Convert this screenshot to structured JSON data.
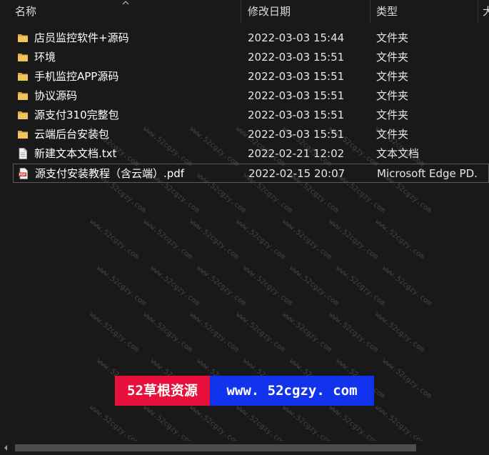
{
  "header": {
    "name": "名称",
    "date": "修改日期",
    "type": "类型",
    "size": "大"
  },
  "files": [
    {
      "name": "店员监控软件+源码",
      "date": "2022-03-03 15:44",
      "type": "文件夹",
      "icon": "folder-icon"
    },
    {
      "name": "环境",
      "date": "2022-03-03 15:51",
      "type": "文件夹",
      "icon": "folder-icon"
    },
    {
      "name": "手机监控APP源码",
      "date": "2022-03-03 15:51",
      "type": "文件夹",
      "icon": "folder-icon"
    },
    {
      "name": "协议源码",
      "date": "2022-03-03 15:51",
      "type": "文件夹",
      "icon": "folder-icon"
    },
    {
      "name": "源支付310完整包",
      "date": "2022-03-03 15:51",
      "type": "文件夹",
      "icon": "folder-icon"
    },
    {
      "name": "云端后台安装包",
      "date": "2022-03-03 15:51",
      "type": "文件夹",
      "icon": "folder-icon"
    },
    {
      "name": "新建文本文档.txt",
      "date": "2022-02-21 12:02",
      "type": "文本文档",
      "icon": "text-file-icon"
    },
    {
      "name": "源支付安装教程（含云端）.pdf",
      "date": "2022-02-15 20:07",
      "type": "Microsoft Edge PD...",
      "icon": "pdf-file-icon"
    }
  ],
  "watermark": {
    "text": "www.52cgzy.com"
  },
  "banner": {
    "left": "52草根资源",
    "right": "www. 52cgzy. com"
  },
  "colors": {
    "background": "#191919",
    "banner_red": "#e8103a",
    "banner_blue": "#1133ee",
    "folder": "#e8b64a"
  }
}
